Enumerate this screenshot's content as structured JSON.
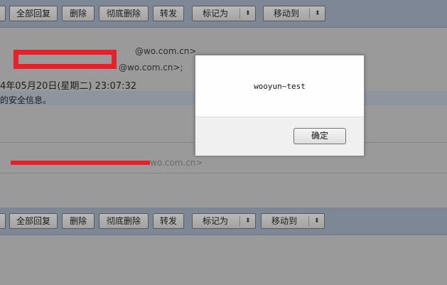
{
  "toolbar": {
    "reply_all": "全部回复",
    "delete": "删除",
    "delete_permanent": "彻底删除",
    "forward": "转发",
    "mark_as": "标记为",
    "move_to": "移动到",
    "dropdown_arrow": "⬍"
  },
  "mail": {
    "sender_email_suffix": "@wo.com.cn>",
    "recipient_email_suffix": "@wo.com.cn>;",
    "date_fragment": "4年05月20日(星期二) 23:07:32",
    "security_notice_fragment": "的安全信息。",
    "quoted_email_suffix": "wo.com.cn>"
  },
  "dialog": {
    "message": "wooyun~test",
    "ok_label": "确定"
  },
  "colors": {
    "redaction": "#e8202a"
  }
}
